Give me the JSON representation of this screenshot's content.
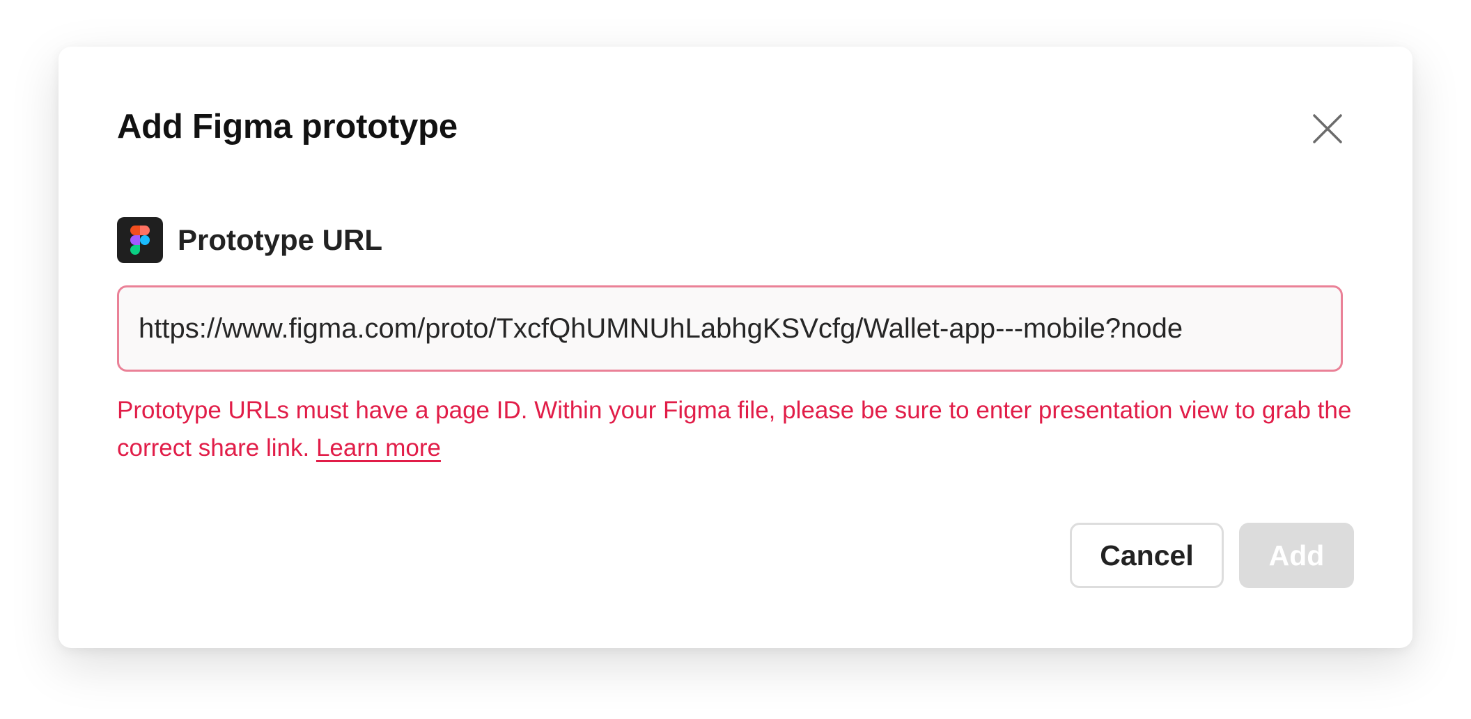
{
  "dialog": {
    "title": "Add Figma prototype",
    "close_icon": "close-icon"
  },
  "field": {
    "label": "Prototype URL",
    "icon": "figma-logo-icon",
    "value": "https://www.figma.com/proto/TxcfQhUMNUhLabhgKSVcfg/Wallet-app---mobile?node",
    "placeholder": ""
  },
  "error": {
    "message": "Prototype URLs must have a page ID. Within your Figma file, please be sure to enter presentation view to grab the correct share link.",
    "link_label": "Learn more"
  },
  "actions": {
    "cancel_label": "Cancel",
    "add_label": "Add",
    "add_disabled": true
  },
  "colors": {
    "error": "#e11d48",
    "input_border_error": "#ea8197",
    "disabled_button": "#dcdcdc"
  }
}
